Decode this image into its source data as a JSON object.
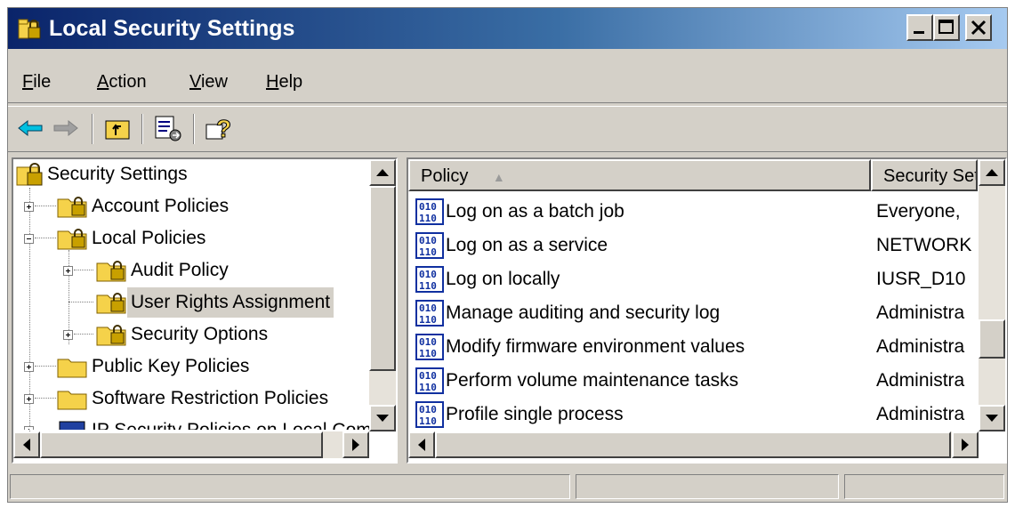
{
  "window": {
    "title": "Local Security Settings",
    "buttons": [
      "minimize-button",
      "maximize-button",
      "close-button"
    ]
  },
  "menu": [
    {
      "accel": "F",
      "rest": "ile"
    },
    {
      "accel": "A",
      "rest": "ction"
    },
    {
      "accel": "V",
      "rest": "iew"
    },
    {
      "accel": "H",
      "rest": "elp"
    }
  ],
  "toolbar": {
    "icons": [
      "back-arrow-icon",
      "forward-arrow-icon",
      "up-one-level-icon",
      "export-list-icon",
      "help-icon"
    ]
  },
  "tree": {
    "items": [
      {
        "label": "Security Settings"
      },
      {
        "label": "Account Policies"
      },
      {
        "label": "Local Policies"
      },
      {
        "label": "Audit Policy"
      },
      {
        "label": "User Rights Assignment",
        "selected": true
      },
      {
        "label": "Security Options"
      },
      {
        "label": "Public Key Policies"
      },
      {
        "label": "Software Restriction Policies"
      },
      {
        "label": "IP Security Policies on Local Computer"
      }
    ]
  },
  "list": {
    "columns": [
      "Policy",
      "Security Setting"
    ],
    "sort_indicator": "▲",
    "rows": [
      {
        "policy": "Log on as a batch job",
        "setting": "Everyone,"
      },
      {
        "policy": "Log on as a service",
        "setting": "NETWORK"
      },
      {
        "policy": "Log on locally",
        "setting": "IUSR_D10"
      },
      {
        "policy": "Manage auditing and security log",
        "setting": "Administra"
      },
      {
        "policy": "Modify firmware environment values",
        "setting": "Administra"
      },
      {
        "policy": "Perform volume maintenance tasks",
        "setting": "Administra"
      },
      {
        "policy": "Profile single process",
        "setting": "Administra"
      }
    ]
  },
  "colors": {
    "title_start": "#0a246a",
    "title_end": "#a6caf0",
    "face": "#d4d0c8",
    "folder": "#f5d24a"
  }
}
